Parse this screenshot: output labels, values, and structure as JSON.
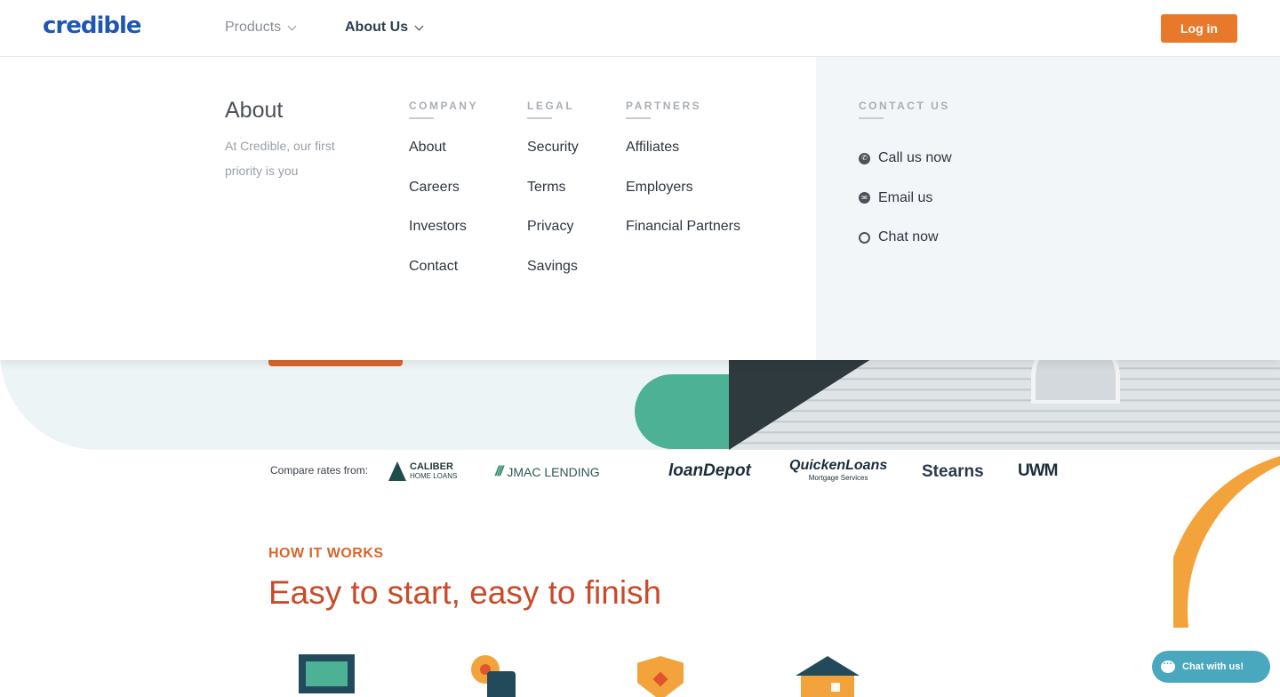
{
  "brand": {
    "logo": "credible",
    "accent": "#e8782a",
    "logo_color": "#1e57b4"
  },
  "header": {
    "nav": [
      {
        "label": "Products",
        "expanded": false
      },
      {
        "label": "About Us",
        "expanded": true
      }
    ],
    "login_label": "Log in"
  },
  "dropdown": {
    "title": "About",
    "description": "At Credible, our first priority is you",
    "columns": [
      {
        "heading": "COMPANY",
        "links": [
          "About",
          "Careers",
          "Investors",
          "Contact"
        ]
      },
      {
        "heading": "LEGAL",
        "links": [
          "Security",
          "Terms",
          "Privacy",
          "Savings"
        ]
      },
      {
        "heading": "PARTNERS",
        "links": [
          "Affiliates",
          "Employers",
          "Financial Partners"
        ]
      }
    ],
    "contact": {
      "heading": "CONTACT US",
      "links": [
        {
          "label": "Call us now",
          "icon": "phone-icon"
        },
        {
          "label": "Email us",
          "icon": "email-icon"
        },
        {
          "label": "Chat now",
          "icon": "chat-circle-icon"
        }
      ]
    }
  },
  "partners": {
    "label": "Compare rates from:",
    "logos": {
      "caliber": {
        "line1": "CALIBER",
        "line2": "HOME LOANS"
      },
      "jmac": "JMAC LENDING",
      "loandepot": "loanDepot",
      "quicken": {
        "main": "QuickenLoans",
        "sub": "Mortgage Services"
      },
      "stearns": "Stearns",
      "uwm": "UWM"
    }
  },
  "how_it_works": {
    "label": "HOW IT WORKS",
    "title": "Easy to start, easy to finish"
  },
  "chat_widget": {
    "label": "Chat with us!"
  }
}
